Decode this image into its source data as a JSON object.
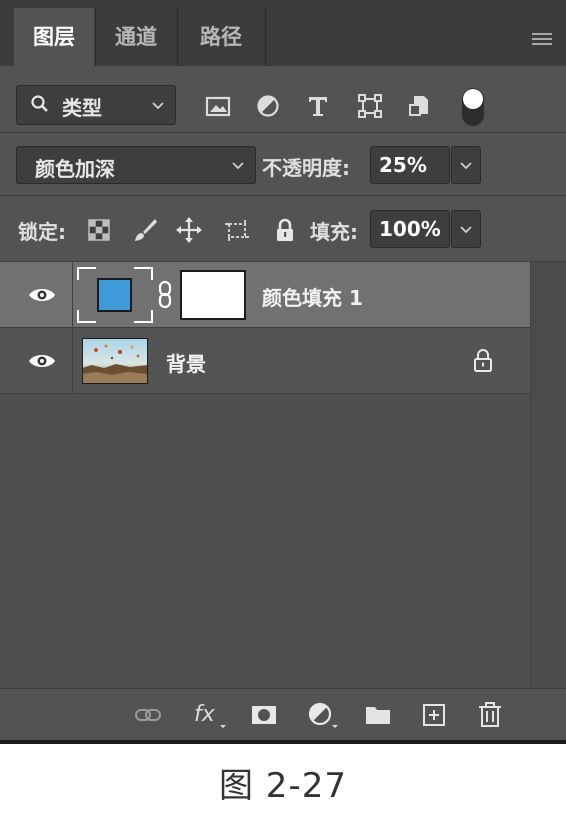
{
  "tabs": [
    {
      "label": "图层",
      "active": true
    },
    {
      "label": "通道",
      "active": false
    },
    {
      "label": "路径",
      "active": false
    }
  ],
  "filter": {
    "kind_label": "类型"
  },
  "blend": {
    "mode": "颜色加深",
    "opacity_label": "不透明度:",
    "opacity_value": "25%"
  },
  "lock": {
    "label": "锁定:",
    "fill_label": "填充:",
    "fill_value": "100%"
  },
  "layers": [
    {
      "name": "颜色填充 1",
      "selected": true,
      "visible": true,
      "fill_color": "#3f9ad9"
    },
    {
      "name": "背景",
      "selected": false,
      "visible": true,
      "locked": true
    }
  ],
  "caption": "图 2-27",
  "colors": {
    "panel": "#535353",
    "selected_row": "#717171",
    "fill_swatch": "#3f9ad9"
  }
}
